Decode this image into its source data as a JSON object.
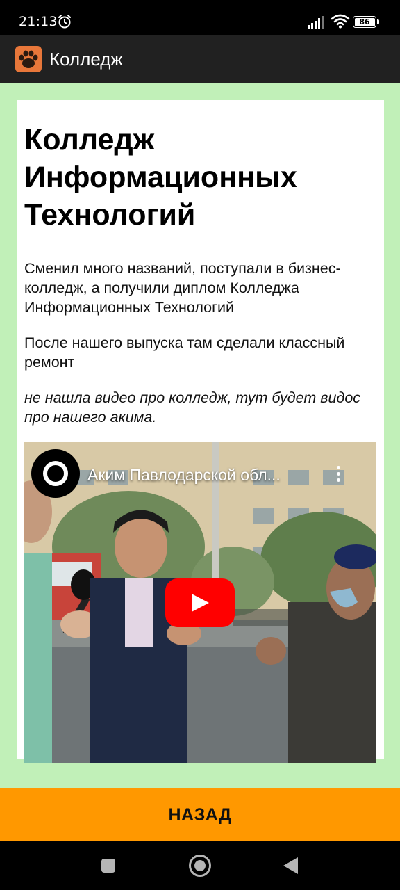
{
  "status_bar": {
    "time": "21:13",
    "battery": "86"
  },
  "app_bar": {
    "title": "Колледж",
    "icon": "paw-icon"
  },
  "article": {
    "headline": "Колледж Информационных Технологий",
    "paragraph1": "Сменил много названий, поступали в бизнес-колледж, а получили диплом Колледжа Информационных Технологий",
    "paragraph2": "После нашего выпуска там сделали классный ремонт",
    "paragraph3": "не нашла видео про колледж, тут будет видос про нашего акима."
  },
  "video": {
    "title": "Аким Павлодарской обл...",
    "icons": [
      "channel-avatar-icon",
      "more-vert-icon",
      "youtube-play-icon"
    ]
  },
  "back_button": {
    "label": "НАЗАД"
  },
  "colors": {
    "content_background": "#c1f0b8",
    "app_bar": "#212121",
    "button": "#ff9800",
    "play_button": "#ff0000"
  }
}
